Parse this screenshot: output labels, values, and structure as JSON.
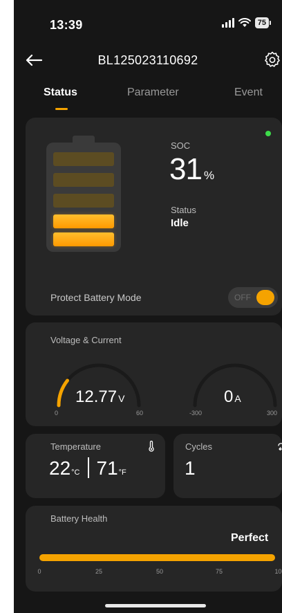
{
  "status_bar": {
    "time": "13:39",
    "battery_level": "75"
  },
  "header": {
    "title": "BL125023110692"
  },
  "tabs": [
    "Status",
    "Parameter",
    "Event"
  ],
  "active_tab": "Status",
  "soc_card": {
    "soc_label": "SOC",
    "soc_value": "31",
    "soc_unit": "%",
    "status_label": "Status",
    "status_value": "Idle",
    "protect_label": "Protect Battery Mode",
    "protect_toggle_text": "OFF",
    "battery_segments_total": 5,
    "battery_segments_lit": 2,
    "accent_color": "#f5a300",
    "indicator_color": "#3ddc4a"
  },
  "voltage_current": {
    "label": "Voltage & Current",
    "voltage": {
      "value": "12.77",
      "unit": "V",
      "min": "0",
      "max": "60",
      "fraction": 0.213
    },
    "current": {
      "value": "0",
      "unit": "A",
      "min": "-300",
      "max": "300",
      "fraction": 0.5
    }
  },
  "temperature": {
    "label": "Temperature",
    "celsius": "22",
    "celsius_unit": "°C",
    "fahrenheit": "71",
    "fahrenheit_unit": "°F"
  },
  "cycles": {
    "label": "Cycles",
    "value": "1"
  },
  "battery_health": {
    "label": "Battery Health",
    "value": "Perfect",
    "ticks": [
      "0",
      "25",
      "50",
      "75",
      "100"
    ],
    "level_percent": 100
  }
}
